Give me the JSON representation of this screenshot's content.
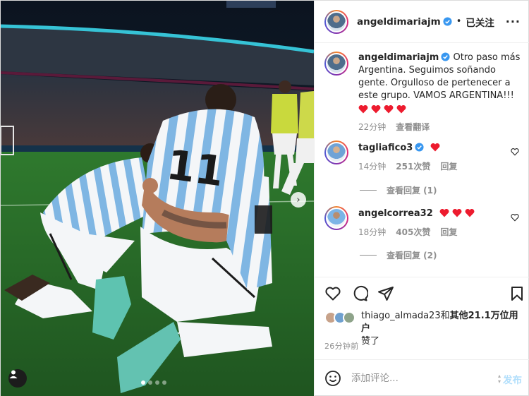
{
  "post": {
    "author": "angeldimariajm",
    "follow_state": "已关注",
    "separator": "•",
    "more_label": "···",
    "caption": "Otro paso más Argentina. Seguimos soñando gente. Orgulloso de pertenecer a este grupo. VAMOS ARGENTINA!!!",
    "caption_time": "22分钟",
    "see_translation": "查看翻译",
    "caption_hearts": 4
  },
  "comments": [
    {
      "username": "tagliafico3",
      "hearts": 1,
      "time": "14分钟",
      "likes": "251次赞",
      "reply": "回复",
      "view_replies": "查看回复 (1)"
    },
    {
      "username": "angelcorrea32",
      "hearts": 3,
      "time": "18分钟",
      "likes": "405次赞",
      "reply": "回复",
      "view_replies": "查看回复 (2)"
    }
  ],
  "likes_summary": {
    "user": "thiago_almada23",
    "connector": "和",
    "others": "其他21.1万位用户",
    "suffix": "赞了"
  },
  "posted_ago": "26分钟前",
  "comment_box": {
    "placeholder": "添加评论...",
    "post_label": "发布"
  },
  "carousel": {
    "total": 4,
    "active_index": 0,
    "next_icon": "›"
  },
  "icons": {
    "verified": "verified-badge-icon",
    "like": "heart-outline-icon",
    "comment": "speech-bubble-icon",
    "share": "paper-plane-icon",
    "save": "bookmark-icon",
    "emoji": "smiley-icon"
  },
  "colors": {
    "verified_blue": "#3897f0",
    "heart_red": "#ed1b2e",
    "post_button_disabled": "#b2dffc",
    "muted_text": "#8e8e8e"
  }
}
